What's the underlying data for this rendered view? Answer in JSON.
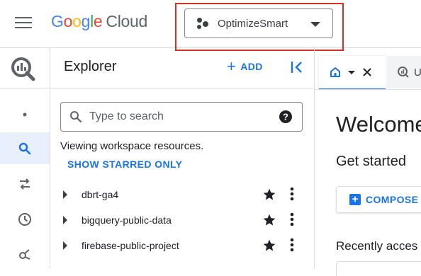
{
  "header": {
    "logo_google": [
      "G",
      "o",
      "o",
      "g",
      "l",
      "e"
    ],
    "logo_product": "Cloud",
    "project_name": "OptimizeSmart"
  },
  "rail": {
    "items": [
      {
        "name": "dot",
        "icon": "dot-icon"
      },
      {
        "name": "search",
        "icon": "search-icon",
        "active": true
      },
      {
        "name": "transfers",
        "icon": "swap-arrows-icon"
      },
      {
        "name": "history",
        "icon": "clock-icon"
      },
      {
        "name": "analytics-hub",
        "icon": "hub-icon"
      }
    ]
  },
  "explorer": {
    "title": "Explorer",
    "add_label": "ADD",
    "search_placeholder": "Type to search",
    "viewing_text": "Viewing workspace resources.",
    "show_starred_label": "SHOW STARRED ONLY",
    "projects": [
      {
        "label": "dbrt-ga4",
        "starred": true
      },
      {
        "label": "bigquery-public-data",
        "starred": true
      },
      {
        "label": "firebase-public-project",
        "starred": true
      }
    ]
  },
  "main": {
    "tab_query_label": "U",
    "welcome": "Welcome",
    "get_started": "Get started",
    "compose_label": "COMPOSE",
    "recently": "Recently acces"
  },
  "colors": {
    "accent": "#1a73e8",
    "highlight_outline": "#d93025",
    "rail_active_bg": "#e8f0fe"
  }
}
